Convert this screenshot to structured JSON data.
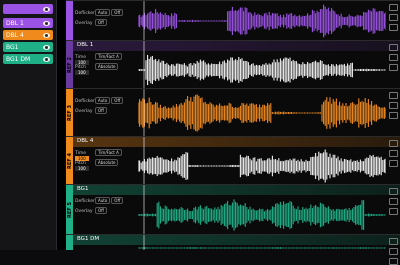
{
  "sidebar": {
    "items": [
      {
        "label": "",
        "color": "#9b53e6"
      },
      {
        "label": "DBL 1",
        "color": "#9b53e6"
      },
      {
        "label": "DBL 4",
        "color": "#f08a1c"
      },
      {
        "label": "BG1",
        "color": "#20b088"
      },
      {
        "label": "BG1 DM",
        "color": "#20b088"
      }
    ]
  },
  "tracks": [
    {
      "tab": "",
      "name": "",
      "color": "#9b53e6",
      "wave_color": "#9b53e6",
      "header": false,
      "rows": [
        {
          "label": "Deflicker",
          "btns": [
            "Auto",
            "Off"
          ]
        },
        {
          "label": "Overlay",
          "btns": [
            "Off"
          ]
        }
      ]
    },
    {
      "tab": "REF 2",
      "name": "DBL 1",
      "color": "#6a3aa0",
      "wave_color": "#f1f1f1",
      "header": true,
      "rows": [
        {
          "label": "Time",
          "btns": [
            "Tim/Fact A"
          ],
          "val": "100",
          "orange": false
        },
        {
          "label": "Pitch",
          "btns": [
            "Absolute"
          ],
          "val": "100"
        },
        {
          "label": "",
          "btns": []
        }
      ]
    },
    {
      "tab": "REF 3",
      "name": "",
      "color": "#f08a1c",
      "wave_color": "#f08a1c",
      "header": false,
      "rows": [
        {
          "label": "Deflicker",
          "btns": [
            "Auto",
            "Off"
          ]
        },
        {
          "label": "Overlay",
          "btns": [
            "Off"
          ]
        }
      ]
    },
    {
      "tab": "REF 4",
      "name": "DBL 4",
      "color": "#f08a1c",
      "wave_color": "#f1f1f1",
      "header": true,
      "rows": [
        {
          "label": "Time",
          "btns": [
            "Tim/Fact A"
          ],
          "val": "100",
          "orange": true
        },
        {
          "label": "Pitch",
          "btns": [
            "Absolute"
          ],
          "val": "100"
        }
      ]
    },
    {
      "tab": "REF 5",
      "name": "BG1",
      "color": "#20b088",
      "wave_color": "#20b088",
      "header": true,
      "rows": [
        {
          "label": "Deflicker",
          "btns": [
            "Auto",
            "Off"
          ]
        },
        {
          "label": "Overlay",
          "btns": [
            "Off"
          ]
        }
      ]
    },
    {
      "tab": "",
      "name": "BG1 DM",
      "color": "#20b088",
      "wave_color": "#20b088",
      "header": true,
      "rows": []
    }
  ]
}
